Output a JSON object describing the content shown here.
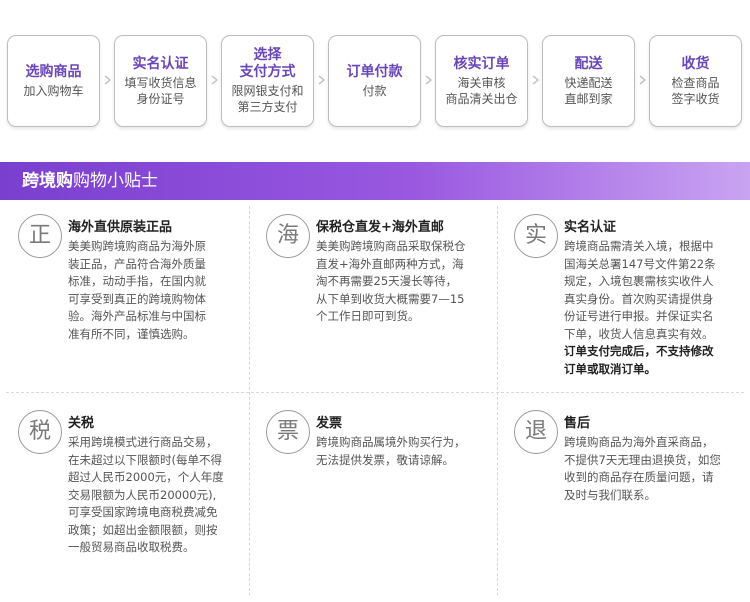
{
  "steps": [
    {
      "title": "选购商品",
      "sub": "加入购物车"
    },
    {
      "title": "实名认证",
      "sub": "填写收货信息\n身份证号"
    },
    {
      "title": "选择\n支付方式",
      "sub": "限网银支付和\n第三方支付"
    },
    {
      "title": "订单付款",
      "sub": "付款"
    },
    {
      "title": "核实订单",
      "sub": "海关审核\n商品清关出仓"
    },
    {
      "title": "配送",
      "sub": "快递配送\n直邮到家"
    },
    {
      "title": "收货",
      "sub": "检查商品\n签字收货"
    }
  ],
  "banner": {
    "bold": "跨境购",
    "rest": "购物小贴士"
  },
  "tips": [
    {
      "badge": "正",
      "title": "海外直供原装正品",
      "body": "美美购跨境购商品为海外原\n装正品，产品符合海外质量\n标准，动动手指，在国内就\n可享受到真正的跨境购物体\n验。海外产品标准与中国标\n准有所不同，谨慎选购。",
      "strong": ""
    },
    {
      "badge": "海",
      "title": "保税仓直发+海外直邮",
      "body": "美美购跨境购商品采取保税仓\n直发+海外直邮两种方式，海\n淘不再需要25天漫长等待，\n从下单到收货大概需要7—15\n个工作日即可到货。",
      "strong": ""
    },
    {
      "badge": "实",
      "title": "实名认证",
      "body": "跨境商品需清关入境，根据中\n国海关总署147号文件第22条\n规定，入境包裹需核实收件人\n真实身份。首次购买请提供身\n份证号进行申报。并保证实名\n下单，收货人信息真实有效。",
      "strong": "订单支付完成后，不支持修改\n订单或取消订单。"
    },
    {
      "badge": "税",
      "title": "关税",
      "body": "采用跨境模式进行商品交易，\n在未超过以下限额时(每单不得\n超过人民币2000元，个人年度\n交易限额为人民币20000元),\n可享受国家跨境电商税费减免\n政策；如超出金额限额，则按\n一般贸易商品收取税费。",
      "strong": ""
    },
    {
      "badge": "票",
      "title": "发票",
      "body": "跨境购商品属境外购买行为，\n无法提供发票，敬请谅解。",
      "strong": ""
    },
    {
      "badge": "退",
      "title": "售后",
      "body": "跨境购商品为海外直采商品，\n不提供7天无理由退换货，如您\n收到的商品存在质量问题，请\n及时与我们联系。",
      "strong": ""
    }
  ]
}
